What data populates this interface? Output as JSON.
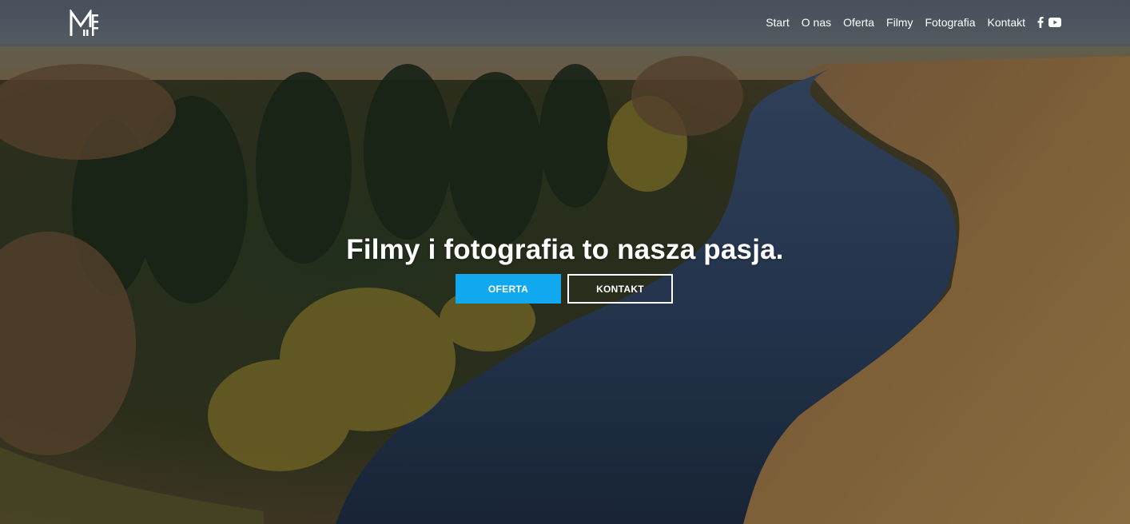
{
  "header": {
    "logo_icon": "mf-logo-icon",
    "nav": [
      {
        "label": "Start"
      },
      {
        "label": "O nas"
      },
      {
        "label": "Oferta"
      },
      {
        "label": "Filmy"
      },
      {
        "label": "Fotografia"
      },
      {
        "label": "Kontakt"
      }
    ],
    "social": [
      "facebook-icon",
      "youtube-icon"
    ]
  },
  "hero": {
    "headline": "Filmy i fotografia to nasza pasja.",
    "primary_button": "OFERTA",
    "secondary_button": "KONTAKT"
  },
  "colors": {
    "accent": "#12a8ef",
    "text": "#ffffff"
  }
}
